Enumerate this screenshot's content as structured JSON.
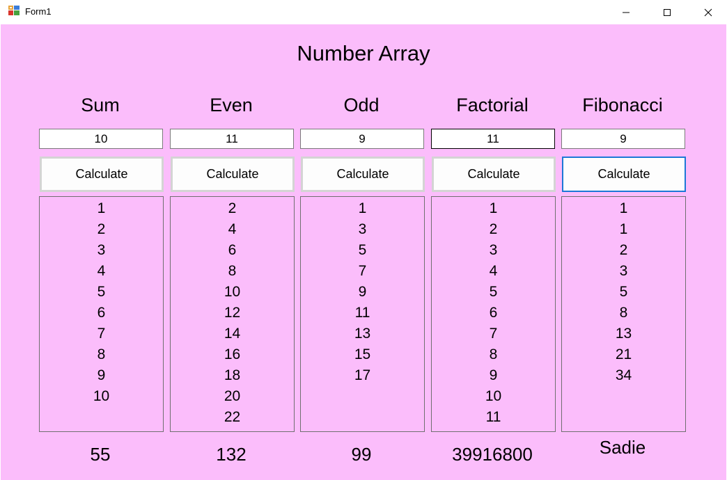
{
  "window": {
    "title": "Form1"
  },
  "form": {
    "title": "Number Array",
    "columns": [
      {
        "header": "Sum",
        "input_value": "10",
        "button_label": "Calculate",
        "items": [
          "1",
          "2",
          "3",
          "4",
          "5",
          "6",
          "7",
          "8",
          "9",
          "10"
        ],
        "result": "55"
      },
      {
        "header": "Even",
        "input_value": "11",
        "button_label": "Calculate",
        "items": [
          "2",
          "4",
          "6",
          "8",
          "10",
          "12",
          "14",
          "16",
          "18",
          "20",
          "22"
        ],
        "result": "132"
      },
      {
        "header": "Odd",
        "input_value": "9",
        "button_label": "Calculate",
        "items": [
          "1",
          "3",
          "5",
          "7",
          "9",
          "11",
          "13",
          "15",
          "17"
        ],
        "result": "99"
      },
      {
        "header": "Factorial",
        "input_value": "11",
        "button_label": "Calculate",
        "items": [
          "1",
          "2",
          "3",
          "4",
          "5",
          "6",
          "7",
          "8",
          "9",
          "10",
          "11"
        ],
        "result": "39916800"
      },
      {
        "header": "Fibonacci",
        "input_value": "9",
        "button_label": "Calculate",
        "items": [
          "1",
          "1",
          "2",
          "3",
          "5",
          "8",
          "13",
          "21",
          "34"
        ],
        "result": "Sadie"
      }
    ]
  },
  "colors": {
    "client_background": "#fbbdfb",
    "focus_border": "#1c78d6"
  }
}
